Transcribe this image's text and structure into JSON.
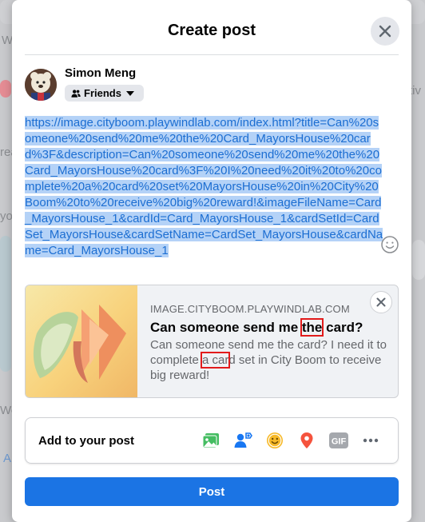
{
  "background": {
    "snippets": [
      "W",
      "rea",
      "yo",
      "Wo",
      "tiv",
      "A"
    ]
  },
  "modal": {
    "title": "Create post",
    "close_icon": "close-icon"
  },
  "user": {
    "name": "Simon Meng",
    "audience": "Friends"
  },
  "post": {
    "text": "https://image.cityboom.playwindlab.com/index.html?title=Can%20someone%20send%20me%20the%20Card_MayorsHouse%20card%3F&description=Can%20someone%20send%20me%20the%20Card_MayorsHouse%20card%3F%20I%20need%20it%20to%20complete%20a%20card%20set%20MayorsHouse%20in%20City%20Boom%20to%20receive%20big%20reward!&imageFileName=Card_MayorsHouse_1&cardId=Card_MayorsHouse_1&cardSetId=CardSet_MayorsHouse&cardSetName=CardSet_MayorsHouse&cardName=Card_MayorsHouse_1"
  },
  "link_preview": {
    "domain": "IMAGE.CITYBOOM.PLAYWINDLAB.COM",
    "title_before": "Can someone send me ",
    "title_highlight": "the",
    "title_after": " card?",
    "desc_before": "Can someone send me the card? I need it to complete ",
    "desc_highlight": "a car",
    "desc_after": "d set in City Boom to receive big reward!"
  },
  "add_to_post": {
    "label": "Add to your post",
    "icons": [
      "photo-video-icon",
      "tag-people-icon",
      "feeling-icon",
      "check-in-icon",
      "gif-icon",
      "more-icon"
    ],
    "gif_label": "GIF"
  },
  "post_button": "Post",
  "colors": {
    "primary": "#1b74e4",
    "selection": "#b4d2f7",
    "highlight_box": "#e21b1b"
  }
}
